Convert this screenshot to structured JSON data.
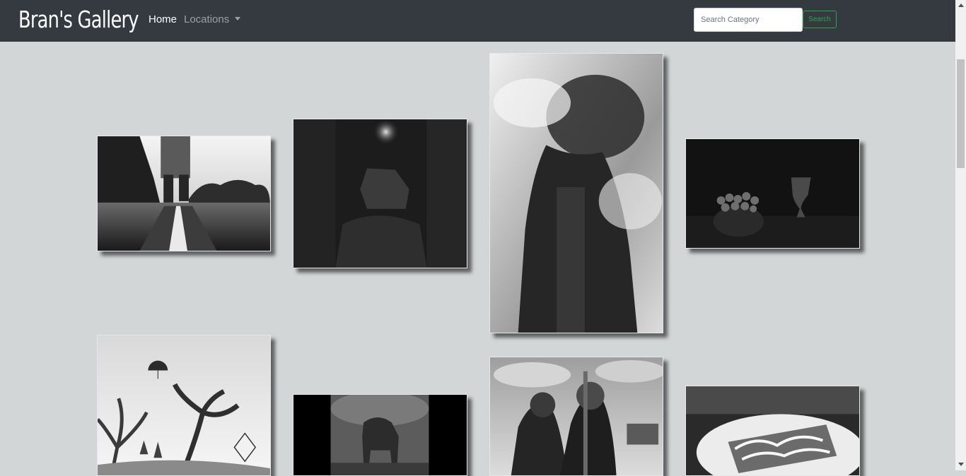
{
  "app": {
    "brand": "Bran's Gallery"
  },
  "nav": {
    "home_label": "Home",
    "locations_label": "Locations"
  },
  "search": {
    "placeholder": "Search Category",
    "value": "",
    "button_label": "Search"
  },
  "colors": {
    "navbar": "#343a40",
    "page_background": "#d3d6d7",
    "search_accent": "#28a745"
  },
  "gallery": [
    {
      "subject": "walking-on-rail-track"
    },
    {
      "subject": "stag-with-glowing-antlers"
    },
    {
      "subject": "double-exposure-portrait-city"
    },
    {
      "subject": "grapes-and-goblet-still-life"
    },
    {
      "subject": "surreal-tree-fantasy"
    },
    {
      "subject": "elephant-in-smoke"
    },
    {
      "subject": "two-masked-soldiers"
    },
    {
      "subject": "waffle-dessert-plate"
    }
  ]
}
